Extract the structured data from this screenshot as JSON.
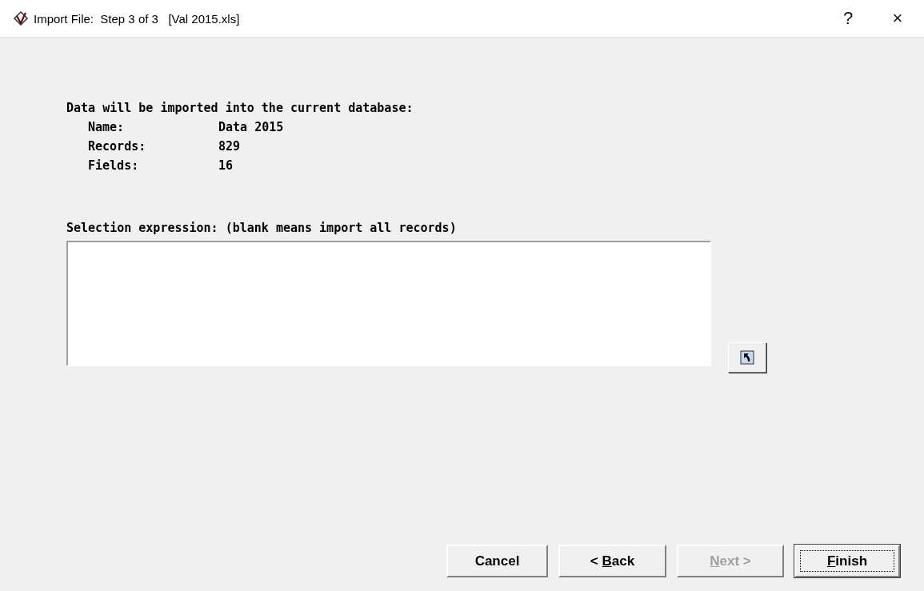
{
  "window": {
    "title": "Import File:  Step 3 of 3   [Val 2015.xls]",
    "help": "?",
    "close": "×"
  },
  "summary": {
    "heading": "Data will be imported into the current database:",
    "rows": [
      {
        "label": "Name:",
        "value": "Data 2015"
      },
      {
        "label": "Records:",
        "value": "829"
      },
      {
        "label": "Fields:",
        "value": "16"
      }
    ]
  },
  "selection": {
    "label": "Selection expression: (blank means import all records)"
  },
  "buttons": [
    {
      "after": "Cancel",
      "disabled": false,
      "default": false
    },
    {
      "before": "< ",
      "key": "B",
      "after": "ack",
      "disabled": false,
      "default": false
    },
    {
      "key": "N",
      "after": "ext >",
      "disabled": true,
      "default": false
    },
    {
      "key": "F",
      "after": "inish",
      "disabled": false,
      "default": true
    }
  ]
}
